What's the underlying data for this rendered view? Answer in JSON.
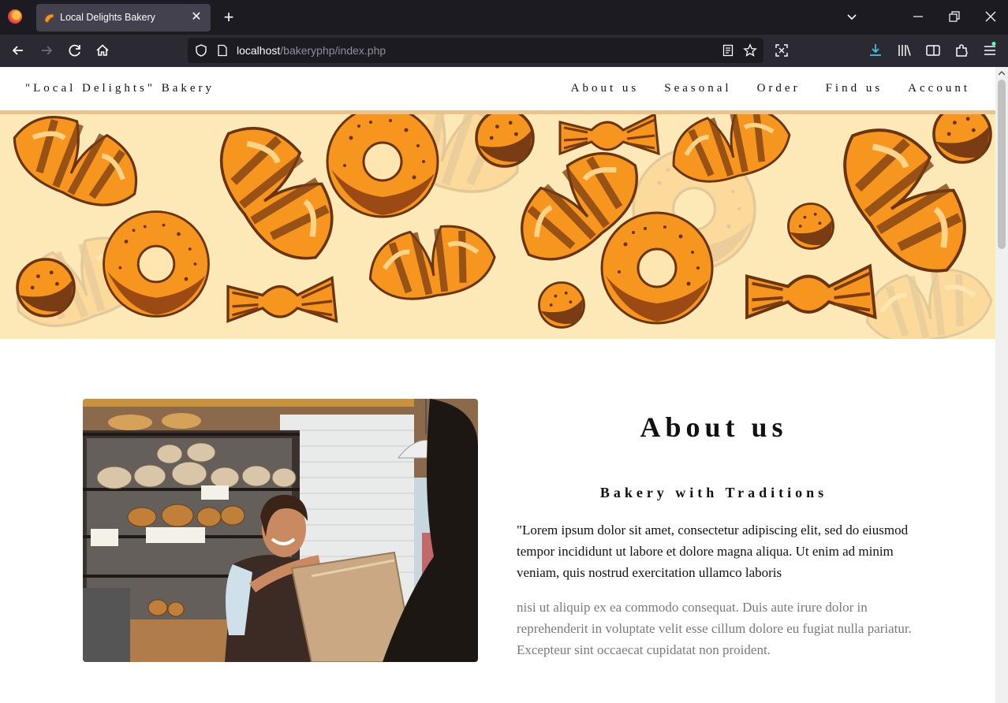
{
  "browser": {
    "tab_title": "Local Delights Bakery",
    "url_host": "localhost",
    "url_path": "/bakeryphp/index.php"
  },
  "site": {
    "brand": "\"Local Delights\" Bakery",
    "nav": [
      "About us",
      "Seasonal",
      "Order",
      "Find us",
      "Account"
    ]
  },
  "about": {
    "title": "About us",
    "subtitle": "Bakery with Traditions",
    "paragraph1": "\"Lorem ipsum dolor sit amet, consectetur adipiscing elit, sed do eiusmod tempor incididunt ut labore et dolore magna aliqua. Ut enim ad minim veniam, quis nostrud exercitation ullamco laboris",
    "paragraph2": "nisi ut aliquip ex ea commodo consequat. Duis aute irure dolor in reprehenderit in voluptate velit esse cillum dolore eu fugiat nulla pariatur. Excepteur sint occaecat cupidatat non proident."
  },
  "colors": {
    "accent_line": "#eac38c",
    "hero_bg": "#fde9b8",
    "pastry_orange": "#f7961e",
    "pastry_brown": "#7a3c12"
  },
  "icons": {
    "browser_nav": [
      "back-icon",
      "forward-icon",
      "reload-icon",
      "home-icon"
    ],
    "browser_tools": [
      "download-icon",
      "library-icon",
      "sidebar-icon",
      "extensions-icon",
      "menu-icon"
    ]
  }
}
